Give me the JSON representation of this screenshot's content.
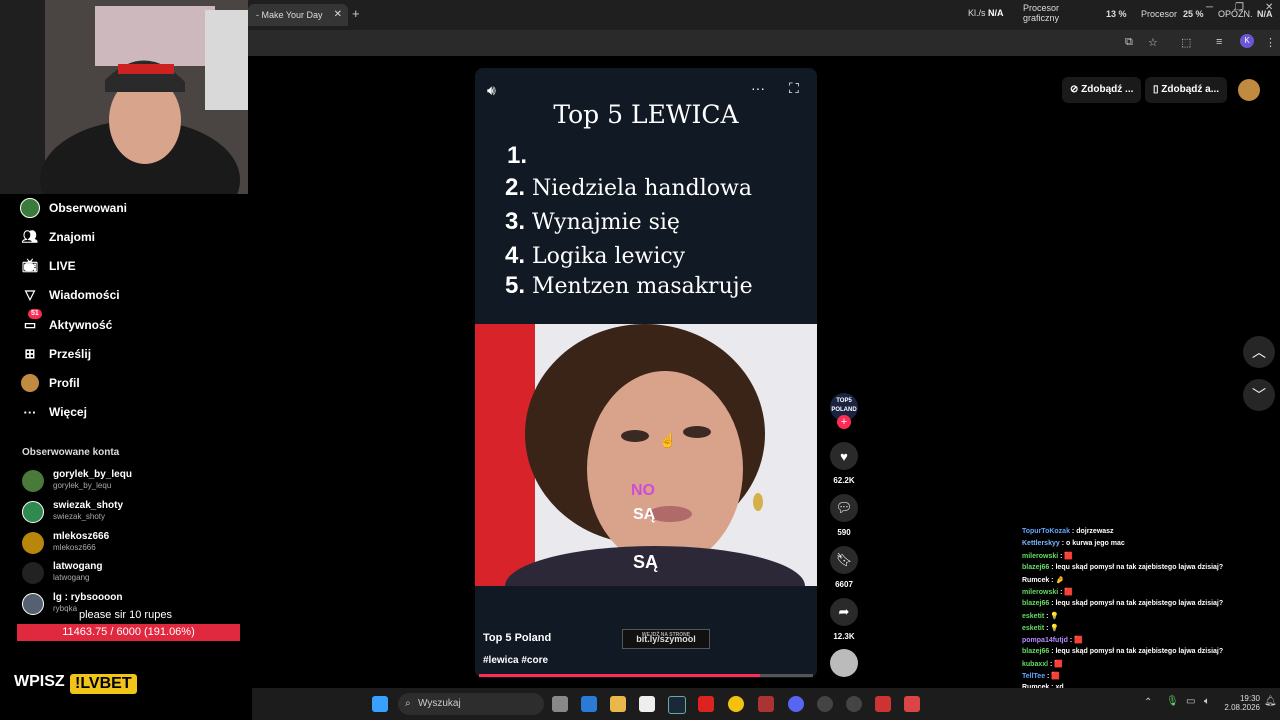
{
  "browser": {
    "tab_title": "- Make Your Day",
    "tab_close": "✕",
    "new_tab": "+",
    "hw_kls_label": "Kl./s",
    "hw_kls_value": "N/A",
    "hw_gpu_label_1": "Procesor",
    "hw_gpu_label_2": "graficzny",
    "hw_gpu_value": "13 %",
    "hw_cpu_label": "Procesor",
    "hw_cpu_value": "25 %",
    "hw_lat_label": "OPÓŹN.",
    "hw_lat_value": "N/A",
    "profile_initial": "K"
  },
  "sidebar": {
    "nav": [
      {
        "label": "Obserwowani",
        "icon": "following-icon"
      },
      {
        "label": "Znajomi",
        "icon": "friends-icon"
      },
      {
        "label": "LIVE",
        "icon": "live-icon"
      },
      {
        "label": "Wiadomości",
        "icon": "messages-icon"
      },
      {
        "label": "Aktywność",
        "icon": "activity-icon",
        "badge": "51"
      },
      {
        "label": "Prześlij",
        "icon": "upload-icon"
      },
      {
        "label": "Profil",
        "icon": "profile-icon"
      },
      {
        "label": "Więcej",
        "icon": "more-icon"
      }
    ],
    "followed_heading": "Obserwowane konta",
    "accounts": [
      {
        "name": "gorylek_by_lequ",
        "handle": "gorylek_by_lequ",
        "color": "#4a7a3a"
      },
      {
        "name": "swiezak_shoty",
        "handle": "swiezak_shoty",
        "color": "#2f8a4f"
      },
      {
        "name": "mlekosz666",
        "handle": "mlekosz666",
        "color": "#b8860b"
      },
      {
        "name": "latwogang",
        "handle": "latwogang",
        "color": "#222222"
      },
      {
        "name": "lg : rybsoooon",
        "handle": "rybqka",
        "color": "#556070"
      }
    ]
  },
  "video": {
    "title": "Top 5 LEWICA",
    "items": [
      {
        "num": "1.",
        "text": ""
      },
      {
        "num": "2.",
        "text": "Niedziela handlowa"
      },
      {
        "num": "3.",
        "text": "Wynajmie się"
      },
      {
        "num": "4.",
        "text": "Logika lewicy"
      },
      {
        "num": "5.",
        "text": "Mentzen masakruje"
      }
    ],
    "caption_1": "NO",
    "caption_2": "SĄ",
    "caption_3": "SĄ",
    "author": "Top 5 Poland",
    "hashtags": "#lewica #core",
    "link_small": "WEJDŹ NA STRONĘ",
    "link": "bit.ly/szymool",
    "progress": 0.84
  },
  "actions": {
    "avatar_text": "TOP5 POLAND",
    "likes": "62.2K",
    "comments": "590",
    "saves": "6607",
    "shares": "12.3K"
  },
  "topright": {
    "btn1": "Zdobądź ...",
    "btn2": "Zdobądź a..."
  },
  "chat": [
    {
      "user": "TopurToKozak",
      "color": "#5fa8ff",
      "text": "dojrzewasz"
    },
    {
      "user": "Kettlerskyy",
      "color": "#7ab8ff",
      "text": "o kurwa jego mac"
    },
    {
      "user": "milerowski",
      "color": "#66dd66",
      "text": "🟥"
    },
    {
      "user": "blazej66",
      "color": "#66dd66",
      "text": "lequ skąd pomysł na tak zajebistego lajwa dzisiaj?"
    },
    {
      "user": "Rumcek",
      "color": "#ffffff",
      "text": "🤌"
    },
    {
      "user": "milerowski",
      "color": "#66dd66",
      "text": "🟥"
    },
    {
      "user": "blazej66",
      "color": "#66dd66",
      "text": "lequ skąd pomysł na tak zajebistego lajwa dzisiaj?"
    },
    {
      "user": "esketit",
      "color": "#66dd66",
      "text": "💡"
    },
    {
      "user": "esketit",
      "color": "#66dd66",
      "text": "💡"
    },
    {
      "user": "pompa14futjd",
      "color": "#b38cff",
      "text": "🟥"
    },
    {
      "user": "blazej66",
      "color": "#66dd66",
      "text": "lequ skąd pomysł na tak zajebistego lajwa dzisiaj?"
    },
    {
      "user": "kubaxxl",
      "color": "#66dd66",
      "text": "🟥"
    },
    {
      "user": "TellTee",
      "color": "#5fa8ff",
      "text": "🟥"
    },
    {
      "user": "Rumcek",
      "color": "#ffffff",
      "text": "xd"
    }
  ],
  "overlay": {
    "donation": "please sir 10 rupes",
    "goal": "11463.75 / 6000 (191.06%)",
    "wpisz": "WPISZ",
    "lvbet": "!LVBET"
  },
  "taskbar": {
    "search": "Wyszukaj",
    "time": "19:30",
    "date": "2.08.2026"
  }
}
